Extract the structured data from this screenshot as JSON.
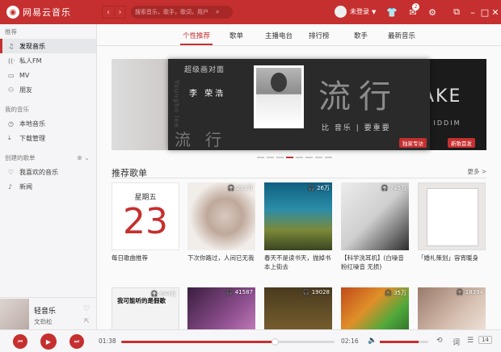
{
  "titlebar": {
    "app_name": "网易云音乐",
    "search_placeholder": "搜索音乐，歌手，歌词，用户",
    "user_label": "未登录",
    "mail_badge": "2"
  },
  "sidebar": {
    "sections": [
      {
        "title": "推荐",
        "items": [
          {
            "label": "发现音乐",
            "icon": "music-note-icon",
            "active": true
          },
          {
            "label": "私人FM",
            "icon": "radio-icon"
          },
          {
            "label": "MV",
            "icon": "video-icon"
          },
          {
            "label": "朋友",
            "icon": "friends-icon"
          }
        ]
      },
      {
        "title": "我的音乐",
        "items": [
          {
            "label": "本地音乐",
            "icon": "local-music-icon"
          },
          {
            "label": "下载管理",
            "icon": "download-icon"
          }
        ]
      },
      {
        "title": "创建的歌单",
        "items": [
          {
            "label": "我喜欢的音乐",
            "icon": "heart-icon"
          },
          {
            "label": "新闻",
            "icon": "playlist-icon"
          }
        ]
      }
    ]
  },
  "now_playing": {
    "title": "轻音乐",
    "artist": "文劲松"
  },
  "tabs": [
    {
      "label": "个性推荐",
      "active": true
    },
    {
      "label": "歌单"
    },
    {
      "label": "主播电台"
    },
    {
      "label": "排行榜"
    },
    {
      "label": "歌手"
    },
    {
      "label": "最新音乐"
    }
  ],
  "banner": {
    "small_title": "超级画对面",
    "artist": "李 荣浩",
    "vertical_text": "Youngho lee",
    "big_text": "流行",
    "bottom_text": "流行",
    "sub_text": "比 音乐 | 要重要",
    "tag": "独家专访",
    "right_text": "AKE",
    "right_sub": "曲\nIDDIM",
    "right_tag": "新歌首发",
    "dots_count": 8,
    "active_dot": 3
  },
  "recommended": {
    "title": "推荐歌单",
    "more": "更多 >",
    "daily": {
      "weekday": "星期五",
      "day": "23",
      "title": "每日歌曲推荐"
    },
    "playlists": [
      {
        "count": "255万",
        "title": "下次你路过，人间已无我"
      },
      {
        "count": "26万",
        "title": "春天不是读书天，抛掉书本上街去"
      },
      {
        "count": "745万",
        "title": "【科学洗耳机】(白噪音 粉红噪音 无损)"
      },
      {
        "count": "",
        "title": "「婚礼策划」容宵暖身"
      }
    ],
    "second_row": [
      {
        "count": "644万",
        "text": "我可能听的是假歌"
      },
      {
        "count": "41587",
        "text": ""
      },
      {
        "count": "19028",
        "text": ""
      },
      {
        "count": "35万",
        "text": ""
      },
      {
        "count": "18394",
        "text": ""
      }
    ]
  },
  "player": {
    "current_time": "01:38",
    "total_time": "02:16",
    "progress": 0.72,
    "volume": 0.8,
    "queue_count": "14"
  }
}
